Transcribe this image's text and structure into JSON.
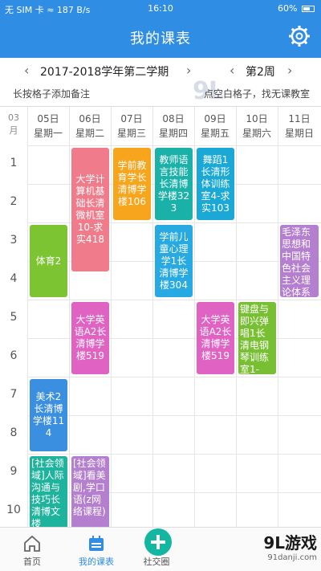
{
  "status": {
    "left": "无 SIM 卡 ≈ 187 B/s",
    "time": "16:10",
    "battery": "60%"
  },
  "header": {
    "title": "我的课表"
  },
  "term": {
    "name": "2017-2018学年第二学期",
    "week": "第2周"
  },
  "hints": {
    "left": "长按格子添加备注",
    "right": "点空白格子，找无课教室"
  },
  "grid": {
    "month": "03\n月",
    "days": [
      {
        "date": "05日",
        "weekday": "星期一"
      },
      {
        "date": "06日",
        "weekday": "星期二"
      },
      {
        "date": "07日",
        "weekday": "星期三"
      },
      {
        "date": "08日",
        "weekday": "星期四"
      },
      {
        "date": "09日",
        "weekday": "星期五"
      },
      {
        "date": "10日",
        "weekday": "星期六"
      },
      {
        "date": "11日",
        "weekday": "星期日"
      }
    ],
    "periods": [
      "1",
      "2",
      "3",
      "4",
      "5",
      "6",
      "7",
      "8",
      "9",
      "10"
    ]
  },
  "courses": [
    {
      "text": "大学计算机基础长清微机室10-求实418",
      "color": "#f07b8b"
    },
    {
      "text": "学前教育学长清博学楼106",
      "color": "#f7a51c"
    },
    {
      "text": "教师语言技能长清博学楼323",
      "color": "#1ab2a8"
    },
    {
      "text": "舞蹈1长清形体训练室4-求实103",
      "color": "#1aa8d6"
    },
    {
      "text": "体育2",
      "color": "#7cc431"
    },
    {
      "text": "学前儿童心理学1长清博学楼304",
      "color": "#27a9e1"
    },
    {
      "text": "毛泽东思想和中国特色社会主义理论体系",
      "color": "#b57fd0"
    },
    {
      "text": "大学英语A2长清博学楼519",
      "color": "#e063c4"
    },
    {
      "text": "大学英语A2长清博学楼519",
      "color": "#e063c4"
    },
    {
      "text": "键盘与即兴弹唱1长清电钢琴训练室1-",
      "color": "#79bf34"
    },
    {
      "text": "美术2长清博学楼114",
      "color": "#3b8fe0"
    },
    {
      "text": "[社会领域]人际沟通与技巧长清博文楼",
      "color": "#1db39c"
    },
    {
      "text": "[社会领域]看美剧,学口语(z网络课程)",
      "color": "#b57fd0"
    }
  ],
  "nav": {
    "home": "首页",
    "schedule": "我的课表",
    "social": "社交圈"
  },
  "watermark": {
    "brand": "9L游戏",
    "site": "91danji.com"
  },
  "colors": {
    "primary": "#2f8de4"
  }
}
